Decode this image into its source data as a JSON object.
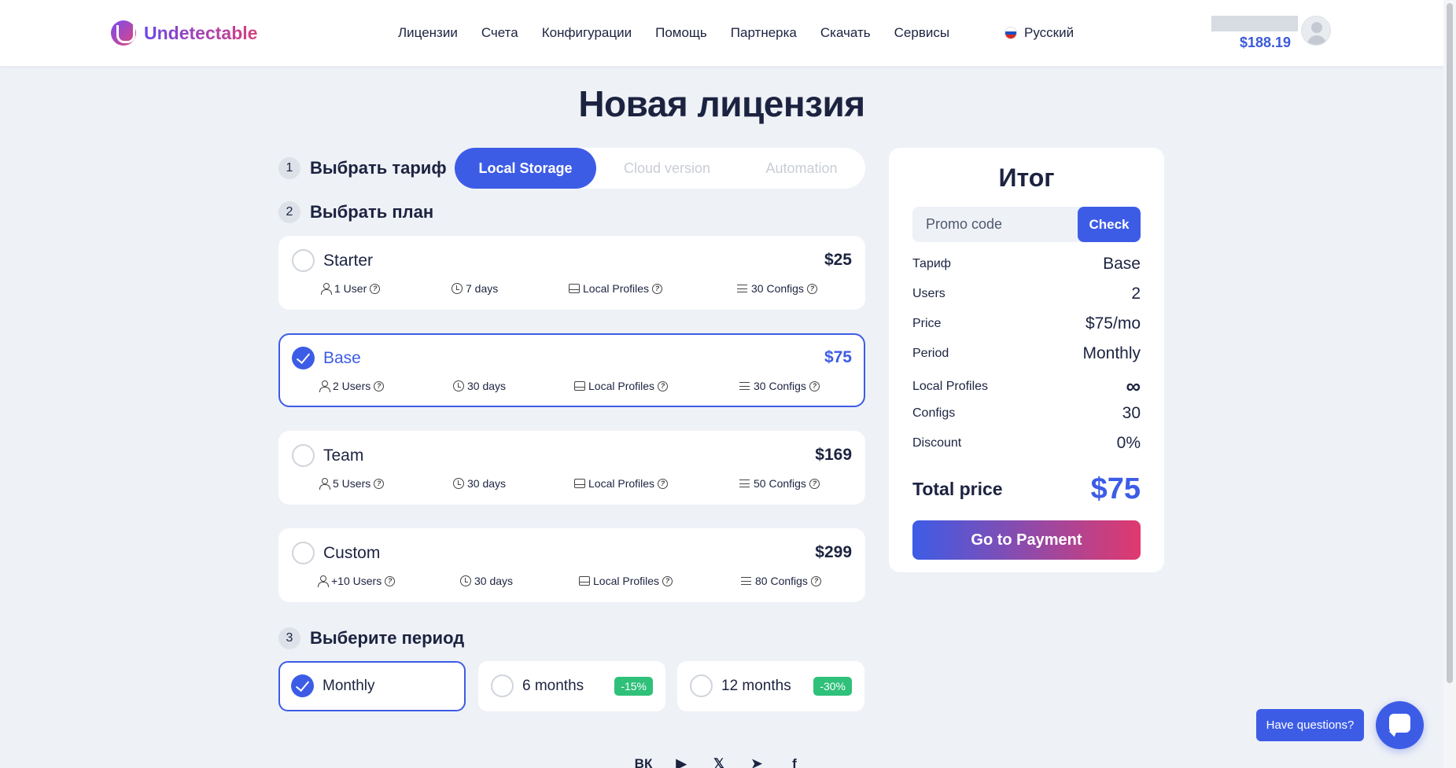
{
  "header": {
    "logo_text": "Undetectable",
    "nav": [
      "Лицензии",
      "Счета",
      "Конфигурации",
      "Помощь",
      "Партнерка",
      "Скачать",
      "Сервисы"
    ],
    "language": "Русский",
    "balance": "$188.19"
  },
  "page_title": "Новая лицензия",
  "step1": {
    "num": "1",
    "label": "Выбрать тариф"
  },
  "tariff_tabs": [
    "Local Storage",
    "Cloud version",
    "Automation"
  ],
  "step2": {
    "num": "2",
    "label": "Выбрать план"
  },
  "plans": [
    {
      "name": "Starter",
      "price": "$25",
      "users": "1 User",
      "days": "7 days",
      "profiles": "Local Profiles",
      "configs": "30 Configs"
    },
    {
      "name": "Base",
      "price": "$75",
      "users": "2 Users",
      "days": "30 days",
      "profiles": "Local Profiles",
      "configs": "30 Configs"
    },
    {
      "name": "Team",
      "price": "$169",
      "users": "5 Users",
      "days": "30 days",
      "profiles": "Local Profiles",
      "configs": "50 Configs"
    },
    {
      "name": "Custom",
      "price": "$299",
      "users": "+10 Users",
      "days": "30 days",
      "profiles": "Local Profiles",
      "configs": "80 Configs"
    }
  ],
  "step3": {
    "num": "3",
    "label": "Выберите период"
  },
  "periods": [
    {
      "label": "Monthly",
      "discount": ""
    },
    {
      "label": "6 months",
      "discount": "-15%"
    },
    {
      "label": "12 months",
      "discount": "-30%"
    }
  ],
  "summary": {
    "title": "Итог",
    "promo_placeholder": "Promo code",
    "check_label": "Check",
    "rows": [
      {
        "k": "Тариф",
        "v": "Base"
      },
      {
        "k": "Users",
        "v": "2"
      },
      {
        "k": "Price",
        "v": "$75/mo"
      },
      {
        "k": "Period",
        "v": "Monthly"
      },
      {
        "k": "Local Profiles",
        "v": "∞"
      },
      {
        "k": "Configs",
        "v": "30"
      },
      {
        "k": "Discount",
        "v": "0%"
      }
    ],
    "total_label": "Total price",
    "total_value": "$75",
    "pay_label": "Go to Payment"
  },
  "social": [
    "vk",
    "youtube",
    "twitter",
    "telegram",
    "facebook"
  ],
  "social_glyphs": [
    "ВК",
    "▶",
    "𝕏",
    "➤",
    "f"
  ],
  "chat": {
    "label": "Have questions?"
  }
}
